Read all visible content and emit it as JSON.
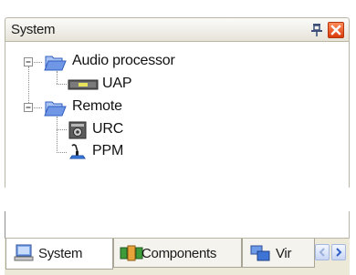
{
  "panel": {
    "title": "System",
    "pin_icon": "pin-icon",
    "close_icon": "close-icon"
  },
  "tree": {
    "nodes": [
      {
        "label": "Audio processor",
        "icon": "folder-open-icon",
        "expanded": true
      },
      {
        "label": "UAP",
        "icon": "audio-processor-device-icon"
      },
      {
        "label": "Remote",
        "icon": "folder-open-icon",
        "expanded": true
      },
      {
        "label": "URC",
        "icon": "remote-control-device-icon"
      },
      {
        "label": "PPM",
        "icon": "microphone-device-icon"
      }
    ]
  },
  "tabs": [
    {
      "label": "System",
      "icon": "computer-icon",
      "active": true
    },
    {
      "label": "Components",
      "icon": "components-icon",
      "active": false
    },
    {
      "label": "Vir",
      "icon": "virtual-devices-icon",
      "active": false
    }
  ],
  "tab_scroll": {
    "left_icon": "chevron-left-icon",
    "right_icon": "chevron-right-icon"
  },
  "colors": {
    "close_button": "#e0501d",
    "scroll_arrow": "#2f5fc4",
    "folder": "#3b6fd8"
  }
}
